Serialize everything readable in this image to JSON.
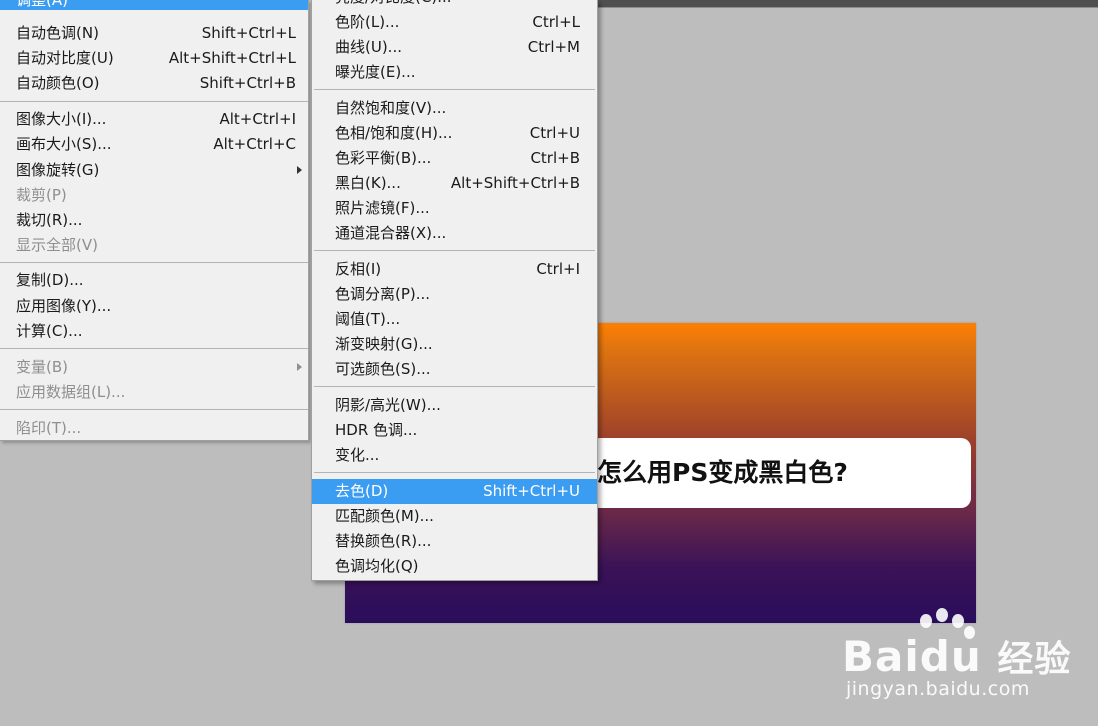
{
  "main_menu": {
    "header_partial": "调整(A)",
    "items": [
      {
        "label": "自动色调(N)",
        "shortcut": "Shift+Ctrl+L"
      },
      {
        "label": "自动对比度(U)",
        "shortcut": "Alt+Shift+Ctrl+L"
      },
      {
        "label": "自动颜色(O)",
        "shortcut": "Shift+Ctrl+B"
      },
      {
        "label": "图像大小(I)...",
        "shortcut": "Alt+Ctrl+I"
      },
      {
        "label": "画布大小(S)...",
        "shortcut": "Alt+Ctrl+C"
      },
      {
        "label": "图像旋转(G)",
        "submenu": true
      },
      {
        "label": "裁剪(P)",
        "disabled": true
      },
      {
        "label": "裁切(R)..."
      },
      {
        "label": "显示全部(V)",
        "disabled": true
      },
      {
        "label": "复制(D)..."
      },
      {
        "label": "应用图像(Y)..."
      },
      {
        "label": "计算(C)..."
      },
      {
        "label": "变量(B)",
        "disabled": true,
        "submenu": true
      },
      {
        "label": "应用数据组(L)...",
        "disabled": true
      },
      {
        "label": "陷印(T)...",
        "disabled": true
      }
    ]
  },
  "sub_menu": {
    "header_partial": "亮度/对比度(C)...",
    "items": [
      {
        "label": "色阶(L)...",
        "shortcut": "Ctrl+L"
      },
      {
        "label": "曲线(U)...",
        "shortcut": "Ctrl+M"
      },
      {
        "label": "曝光度(E)..."
      },
      {
        "label": "自然饱和度(V)..."
      },
      {
        "label": "色相/饱和度(H)...",
        "shortcut": "Ctrl+U"
      },
      {
        "label": "色彩平衡(B)...",
        "shortcut": "Ctrl+B"
      },
      {
        "label": "黑白(K)...",
        "shortcut": "Alt+Shift+Ctrl+B"
      },
      {
        "label": "照片滤镜(F)..."
      },
      {
        "label": "通道混合器(X)..."
      },
      {
        "label": "反相(I)",
        "shortcut": "Ctrl+I"
      },
      {
        "label": "色调分离(P)..."
      },
      {
        "label": "阈值(T)..."
      },
      {
        "label": "渐变映射(G)..."
      },
      {
        "label": "可选颜色(S)..."
      },
      {
        "label": "阴影/高光(W)..."
      },
      {
        "label": "HDR 色调..."
      },
      {
        "label": "变化..."
      },
      {
        "label": "去色(D)",
        "shortcut": "Shift+Ctrl+U",
        "highlighted": true
      },
      {
        "label": "匹配颜色(M)..."
      },
      {
        "label": "替换颜色(R)..."
      },
      {
        "label": "色调均化(Q)"
      }
    ]
  },
  "canvas": {
    "title": "怎么用PS变成黑白色?",
    "gradient_colors": [
      "#ff7f04",
      "#9a3f2c",
      "#2a0d5a"
    ]
  },
  "watermark": {
    "brand": "Baidu",
    "brand_cn": "经验",
    "url": "jingyan.baidu.com"
  },
  "colors": {
    "highlight": "#3a9df2",
    "menu_bg": "#f0f0f0",
    "workspace_bg": "#bdbdbd"
  }
}
